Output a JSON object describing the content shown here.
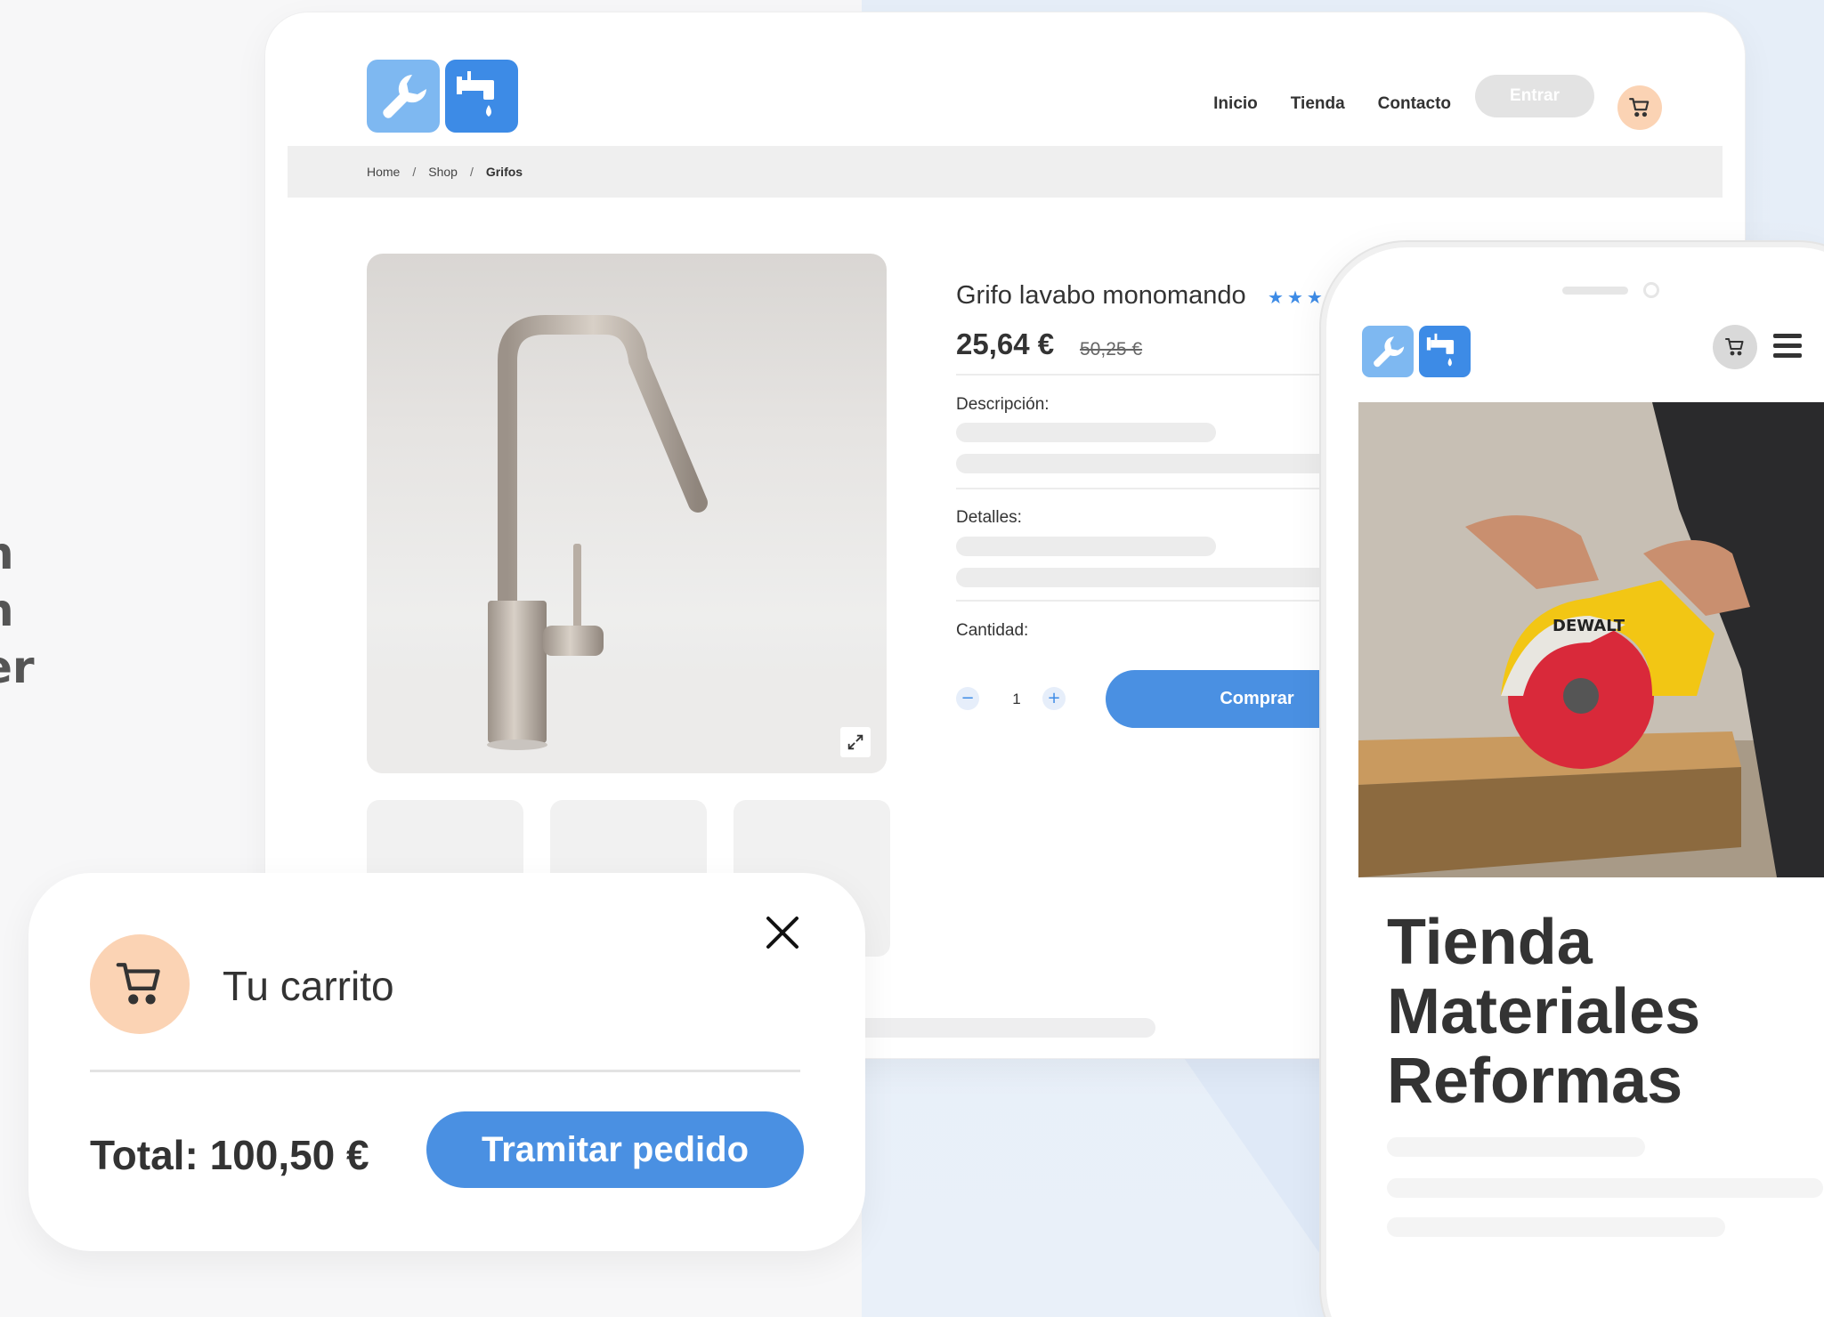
{
  "side_text": [
    "n",
    "n",
    "er"
  ],
  "header": {
    "nav": [
      "Inicio",
      "Tienda",
      "Contacto"
    ],
    "login_label": "Entrar"
  },
  "breadcrumb": {
    "items": [
      "Home",
      "Shop",
      "Grifos"
    ],
    "separator": "/"
  },
  "product": {
    "title": "Grifo lavabo monomando",
    "rating": 4,
    "price": "25,64 €",
    "old_price": "50,25 €",
    "description_label": "Descripción:",
    "details_label": "Detalles:",
    "quantity_label": "Cantidad:",
    "quantity": "1",
    "qty_minus": "−",
    "qty_plus": "+",
    "buy_label": "Comprar"
  },
  "cart_popup": {
    "title": "Tu carrito",
    "total": "Total: 100,50 €",
    "checkout_label": "Tramitar pedido"
  },
  "mobile": {
    "hero_brand": "DEWALT",
    "title_lines": [
      "Tienda",
      "Materiales",
      "Reformas"
    ]
  },
  "colors": {
    "accent": "#4a90e2",
    "cart_badge": "#fbd3b4",
    "logo_light": "#7eb8f1",
    "logo_dark": "#3d8be6"
  },
  "icons": [
    "wrench-icon",
    "faucet-icon",
    "cart-icon",
    "close-icon",
    "expand-icon",
    "menu-icon",
    "star-icon"
  ]
}
